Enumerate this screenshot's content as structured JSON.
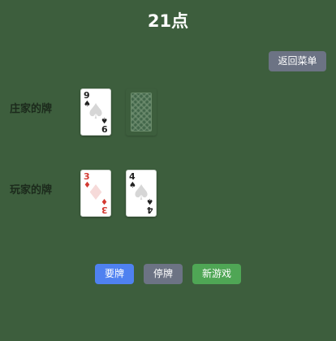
{
  "title": "21点",
  "back_button": "返回菜单",
  "dealer": {
    "label": "庄家的牌",
    "cards": [
      {
        "rank": "9",
        "suit": "♠",
        "color": "black",
        "face_up": true
      },
      {
        "face_up": false
      }
    ]
  },
  "player": {
    "label": "玩家的牌",
    "cards": [
      {
        "rank": "3",
        "suit": "♦",
        "color": "red",
        "face_up": true
      },
      {
        "rank": "4",
        "suit": "♠",
        "color": "black",
        "face_up": true
      }
    ]
  },
  "actions": {
    "hit": {
      "label": "要牌",
      "color": "#4f81f0"
    },
    "stand": {
      "label": "停牌",
      "color": "#6c7384"
    },
    "new_game": {
      "label": "新游戏",
      "color": "#4fa655"
    }
  },
  "colors": {
    "table": "#3d5e3d",
    "red_suit": "#d33a32",
    "black_suit": "#222222"
  }
}
